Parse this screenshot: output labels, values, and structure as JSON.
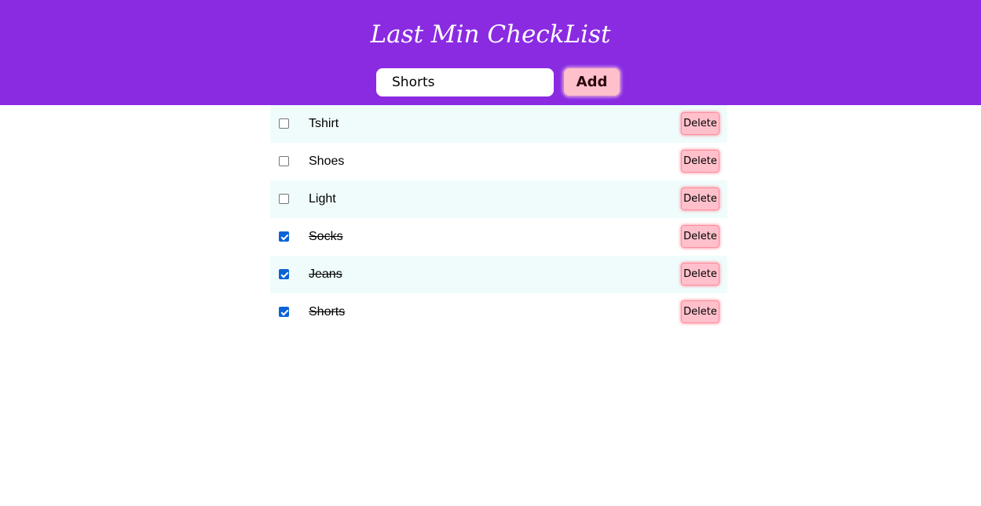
{
  "header": {
    "title": "Last Min CheckList",
    "background": "#8a2be2"
  },
  "add_form": {
    "input_value": "Shorts",
    "add_label": "Add"
  },
  "items": [
    {
      "label": "Tshirt",
      "checked": false,
      "delete_label": "Delete"
    },
    {
      "label": "Shoes",
      "checked": false,
      "delete_label": "Delete"
    },
    {
      "label": "Light",
      "checked": false,
      "delete_label": "Delete"
    },
    {
      "label": "Socks",
      "checked": true,
      "delete_label": "Delete"
    },
    {
      "label": "Jeans",
      "checked": true,
      "delete_label": "Delete"
    },
    {
      "label": "Shorts",
      "checked": true,
      "delete_label": "Delete"
    }
  ],
  "colors": {
    "accent": "#8a2be2",
    "button_pink": "#ffc0cb",
    "row_alt": "#f0fcfc",
    "checkbox_checked": "#0b63d6"
  }
}
